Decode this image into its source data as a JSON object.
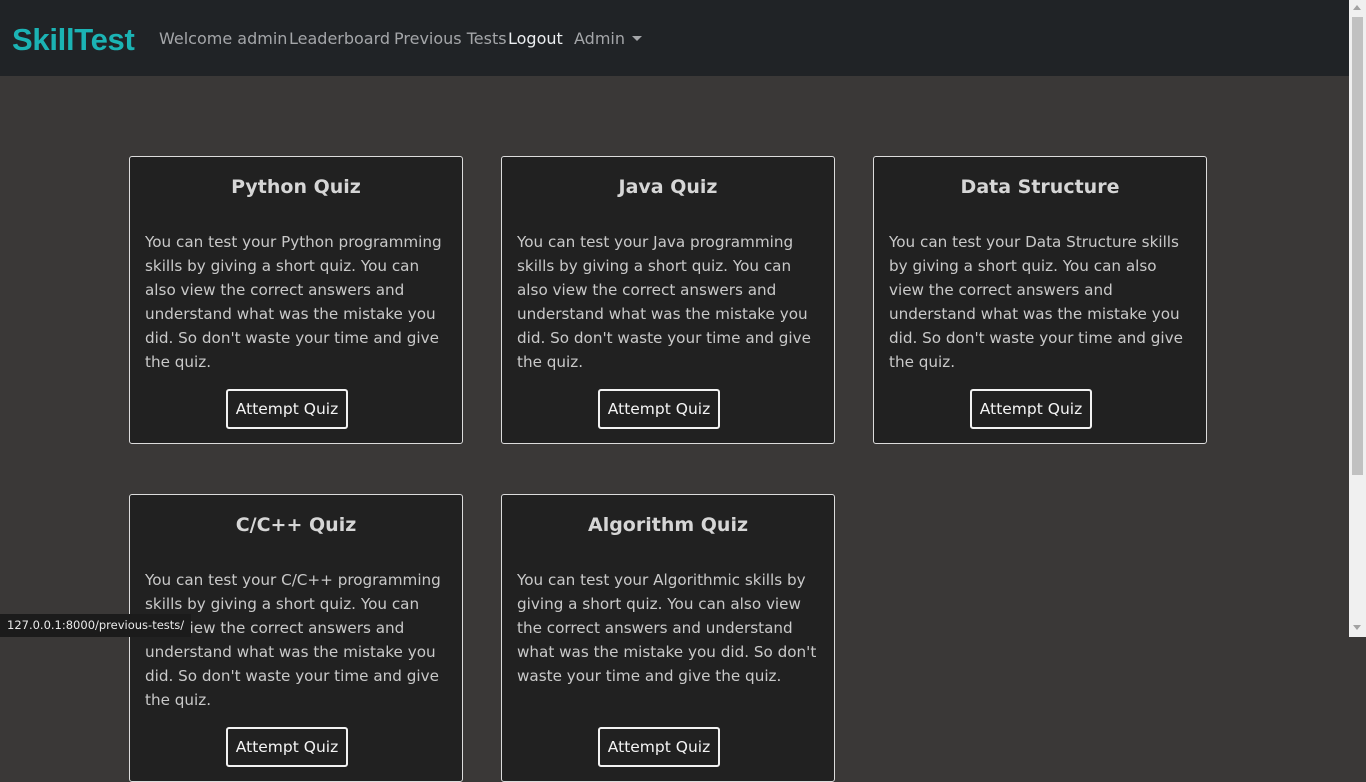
{
  "navbar": {
    "brand": "SkillTest",
    "links": [
      {
        "label": "Welcome admin"
      },
      {
        "label": "Leaderboard"
      },
      {
        "label": "Previous Tests"
      },
      {
        "label": "Logout"
      },
      {
        "label": "Admin"
      }
    ]
  },
  "cards": [
    {
      "title": "Python Quiz",
      "text": "You can test your Python programming skills by giving a short quiz. You can also view the correct answers and understand what was the mistake you did. So don't waste your time and give the quiz.",
      "button": "Attempt Quiz"
    },
    {
      "title": "Java Quiz",
      "text": "You can test your Java programming skills by giving a short quiz. You can also view the correct answers and understand what was the mistake you did. So don't waste your time and give the quiz.",
      "button": "Attempt Quiz"
    },
    {
      "title": "Data Structure",
      "text": "You can test your Data Structure skills by giving a short quiz. You can also view the correct answers and understand what was the mistake you did. So don't waste your time and give the quiz.",
      "button": "Attempt Quiz"
    },
    {
      "title": "C/C++ Quiz",
      "text": "You can test your C/C++ programming skills by giving a short quiz. You can also view the correct answers and understand what was the mistake you did. So don't waste your time and give the quiz.",
      "button": "Attempt Quiz"
    },
    {
      "title": "Algorithm Quiz",
      "text": "You can test your Algorithmic skills by giving a short quiz. You can also view the correct answers and understand what was the mistake you did. So don't waste your time and give the quiz.",
      "button": "Attempt Quiz"
    }
  ],
  "status_bar": {
    "url": "127.0.0.1:8000/previous-tests/"
  },
  "colors": {
    "brand": "#1bb3b4",
    "navbar_bg": "#202326",
    "page_bg": "#3a3837",
    "card_bg": "#212121"
  }
}
